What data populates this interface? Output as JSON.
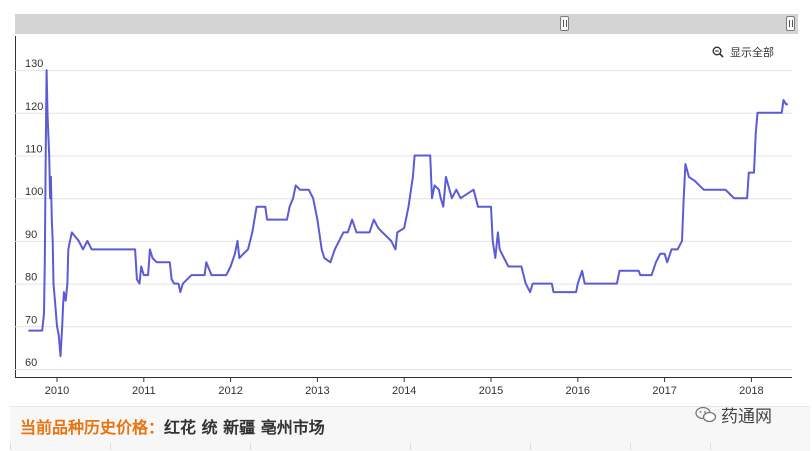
{
  "reset_zoom_label": "显示全部",
  "footer": {
    "label": "当前品种历史价格：",
    "product": "红花 统 新疆 亳州市场"
  },
  "watermark": "药通网",
  "colors": {
    "line": "#5b5bd6",
    "label_orange": "#e8730f",
    "scroller": "#d4d4d4"
  },
  "chart_data": {
    "type": "line",
    "title": "",
    "xlabel": "",
    "ylabel": "",
    "x_ticks": [
      "2010",
      "2011",
      "2012",
      "2013",
      "2014",
      "2015",
      "2016",
      "2017",
      "2018"
    ],
    "y_ticks": [
      60,
      70,
      80,
      90,
      100,
      110,
      120,
      130
    ],
    "xlim": [
      2009.67,
      2018.42
    ],
    "ylim": [
      58,
      133
    ],
    "grid": "horizontal",
    "series": [
      {
        "points": [
          [
            2009.67,
            69
          ],
          [
            2009.83,
            69
          ],
          [
            2009.85,
            73
          ],
          [
            2009.86,
            85
          ],
          [
            2009.87,
            110
          ],
          [
            2009.88,
            130
          ],
          [
            2009.89,
            120
          ],
          [
            2009.9,
            115
          ],
          [
            2009.91,
            110
          ],
          [
            2009.92,
            100
          ],
          [
            2009.93,
            105
          ],
          [
            2009.94,
            95
          ],
          [
            2009.95,
            90
          ],
          [
            2009.96,
            80
          ],
          [
            2009.98,
            75
          ],
          [
            2010.0,
            70
          ],
          [
            2010.02,
            68
          ],
          [
            2010.04,
            63
          ],
          [
            2010.06,
            70
          ],
          [
            2010.07,
            75
          ],
          [
            2010.08,
            78
          ],
          [
            2010.1,
            76
          ],
          [
            2010.12,
            80
          ],
          [
            2010.13,
            88
          ],
          [
            2010.15,
            90
          ],
          [
            2010.17,
            92
          ],
          [
            2010.25,
            90
          ],
          [
            2010.3,
            88
          ],
          [
            2010.35,
            90
          ],
          [
            2010.4,
            88
          ],
          [
            2010.9,
            88
          ],
          [
            2010.92,
            81
          ],
          [
            2010.95,
            80
          ],
          [
            2010.97,
            84
          ],
          [
            2011.0,
            82
          ],
          [
            2011.05,
            82
          ],
          [
            2011.07,
            88
          ],
          [
            2011.1,
            86
          ],
          [
            2011.15,
            85
          ],
          [
            2011.3,
            85
          ],
          [
            2011.32,
            81
          ],
          [
            2011.35,
            80
          ],
          [
            2011.4,
            80
          ],
          [
            2011.42,
            78
          ],
          [
            2011.45,
            80
          ],
          [
            2011.55,
            82
          ],
          [
            2011.7,
            82
          ],
          [
            2011.72,
            85
          ],
          [
            2011.78,
            82
          ],
          [
            2011.95,
            82
          ],
          [
            2012.0,
            84
          ],
          [
            2012.05,
            87
          ],
          [
            2012.08,
            90
          ],
          [
            2012.1,
            86
          ],
          [
            2012.15,
            87
          ],
          [
            2012.2,
            88
          ],
          [
            2012.25,
            92
          ],
          [
            2012.3,
            98
          ],
          [
            2012.4,
            98
          ],
          [
            2012.42,
            95
          ],
          [
            2012.65,
            95
          ],
          [
            2012.68,
            98
          ],
          [
            2012.72,
            100
          ],
          [
            2012.75,
            103
          ],
          [
            2012.8,
            102
          ],
          [
            2012.9,
            102
          ],
          [
            2012.95,
            100
          ],
          [
            2013.0,
            95
          ],
          [
            2013.05,
            88
          ],
          [
            2013.08,
            86
          ],
          [
            2013.15,
            85
          ],
          [
            2013.2,
            88
          ],
          [
            2013.25,
            90
          ],
          [
            2013.3,
            92
          ],
          [
            2013.35,
            92
          ],
          [
            2013.4,
            95
          ],
          [
            2013.45,
            92
          ],
          [
            2013.6,
            92
          ],
          [
            2013.65,
            95
          ],
          [
            2013.7,
            93
          ],
          [
            2013.75,
            92
          ],
          [
            2013.85,
            90
          ],
          [
            2013.9,
            88
          ],
          [
            2013.92,
            92
          ],
          [
            2014.0,
            93
          ],
          [
            2014.05,
            98
          ],
          [
            2014.1,
            105
          ],
          [
            2014.12,
            110
          ],
          [
            2014.3,
            110
          ],
          [
            2014.32,
            100
          ],
          [
            2014.35,
            103
          ],
          [
            2014.4,
            102
          ],
          [
            2014.42,
            100
          ],
          [
            2014.45,
            98
          ],
          [
            2014.48,
            105
          ],
          [
            2014.55,
            100
          ],
          [
            2014.6,
            102
          ],
          [
            2014.65,
            100
          ],
          [
            2014.8,
            102
          ],
          [
            2014.85,
            98
          ],
          [
            2015.0,
            98
          ],
          [
            2015.02,
            90
          ],
          [
            2015.05,
            86
          ],
          [
            2015.08,
            92
          ],
          [
            2015.1,
            88
          ],
          [
            2015.15,
            86
          ],
          [
            2015.2,
            84
          ],
          [
            2015.35,
            84
          ],
          [
            2015.4,
            80
          ],
          [
            2015.45,
            78
          ],
          [
            2015.48,
            80
          ],
          [
            2015.7,
            80
          ],
          [
            2015.72,
            78
          ],
          [
            2015.98,
            78
          ],
          [
            2016.0,
            80
          ],
          [
            2016.05,
            83
          ],
          [
            2016.08,
            80
          ],
          [
            2016.45,
            80
          ],
          [
            2016.48,
            83
          ],
          [
            2016.7,
            83
          ],
          [
            2016.72,
            82
          ],
          [
            2016.85,
            82
          ],
          [
            2016.9,
            85
          ],
          [
            2016.95,
            87
          ],
          [
            2017.0,
            87
          ],
          [
            2017.03,
            85
          ],
          [
            2017.08,
            88
          ],
          [
            2017.15,
            88
          ],
          [
            2017.2,
            90
          ],
          [
            2017.22,
            100
          ],
          [
            2017.24,
            108
          ],
          [
            2017.28,
            105
          ],
          [
            2017.35,
            104
          ],
          [
            2017.4,
            103
          ],
          [
            2017.45,
            102
          ],
          [
            2017.7,
            102
          ],
          [
            2017.75,
            101
          ],
          [
            2017.8,
            100
          ],
          [
            2017.95,
            100
          ],
          [
            2017.97,
            106
          ],
          [
            2018.03,
            106
          ],
          [
            2018.05,
            115
          ],
          [
            2018.07,
            120
          ],
          [
            2018.35,
            120
          ],
          [
            2018.37,
            123
          ],
          [
            2018.4,
            122
          ],
          [
            2018.42,
            122
          ]
        ]
      }
    ]
  }
}
